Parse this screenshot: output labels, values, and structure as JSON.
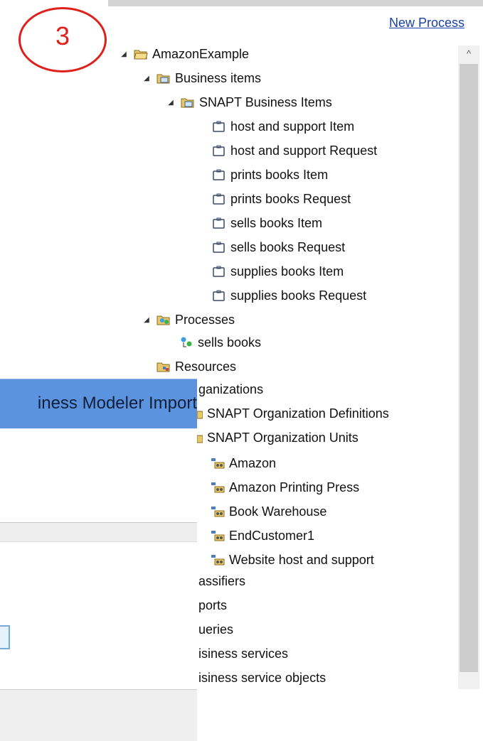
{
  "header": {
    "new_process_label": "New Process"
  },
  "annotation": {
    "step_number": "3"
  },
  "dialog": {
    "title_fragment": "iness Modeler Import"
  },
  "tree": {
    "root": "AmazonExample",
    "business_items": "Business items",
    "snapt_business_items": "SNAPT Business Items",
    "items": [
      "host and support Item",
      "host and support Request",
      "prints books Item",
      "prints books Request",
      "sells books Item",
      "sells books Request",
      "supplies books Item",
      "supplies books Request"
    ],
    "processes": "Processes",
    "sells_books_process": "sells books",
    "resources": "Resources",
    "organizations_fragment": "ganizations",
    "org_definitions": "SNAPT Organization Definitions",
    "org_units": "SNAPT Organization Units",
    "units": [
      "Amazon",
      "Amazon Printing Press",
      "Book Warehouse",
      "EndCustomer1",
      "Website host and support"
    ],
    "classifiers_fragment": "assifiers",
    "reports_fragment": "ports",
    "queries_fragment": "ueries",
    "business_services_fragment": "isiness services",
    "business_service_objects_fragment": "isiness service objects"
  },
  "colors": {
    "annotation_red": "#e0201b",
    "link_blue": "#1a3fa8",
    "dialog_title_blue": "#5b93de"
  }
}
